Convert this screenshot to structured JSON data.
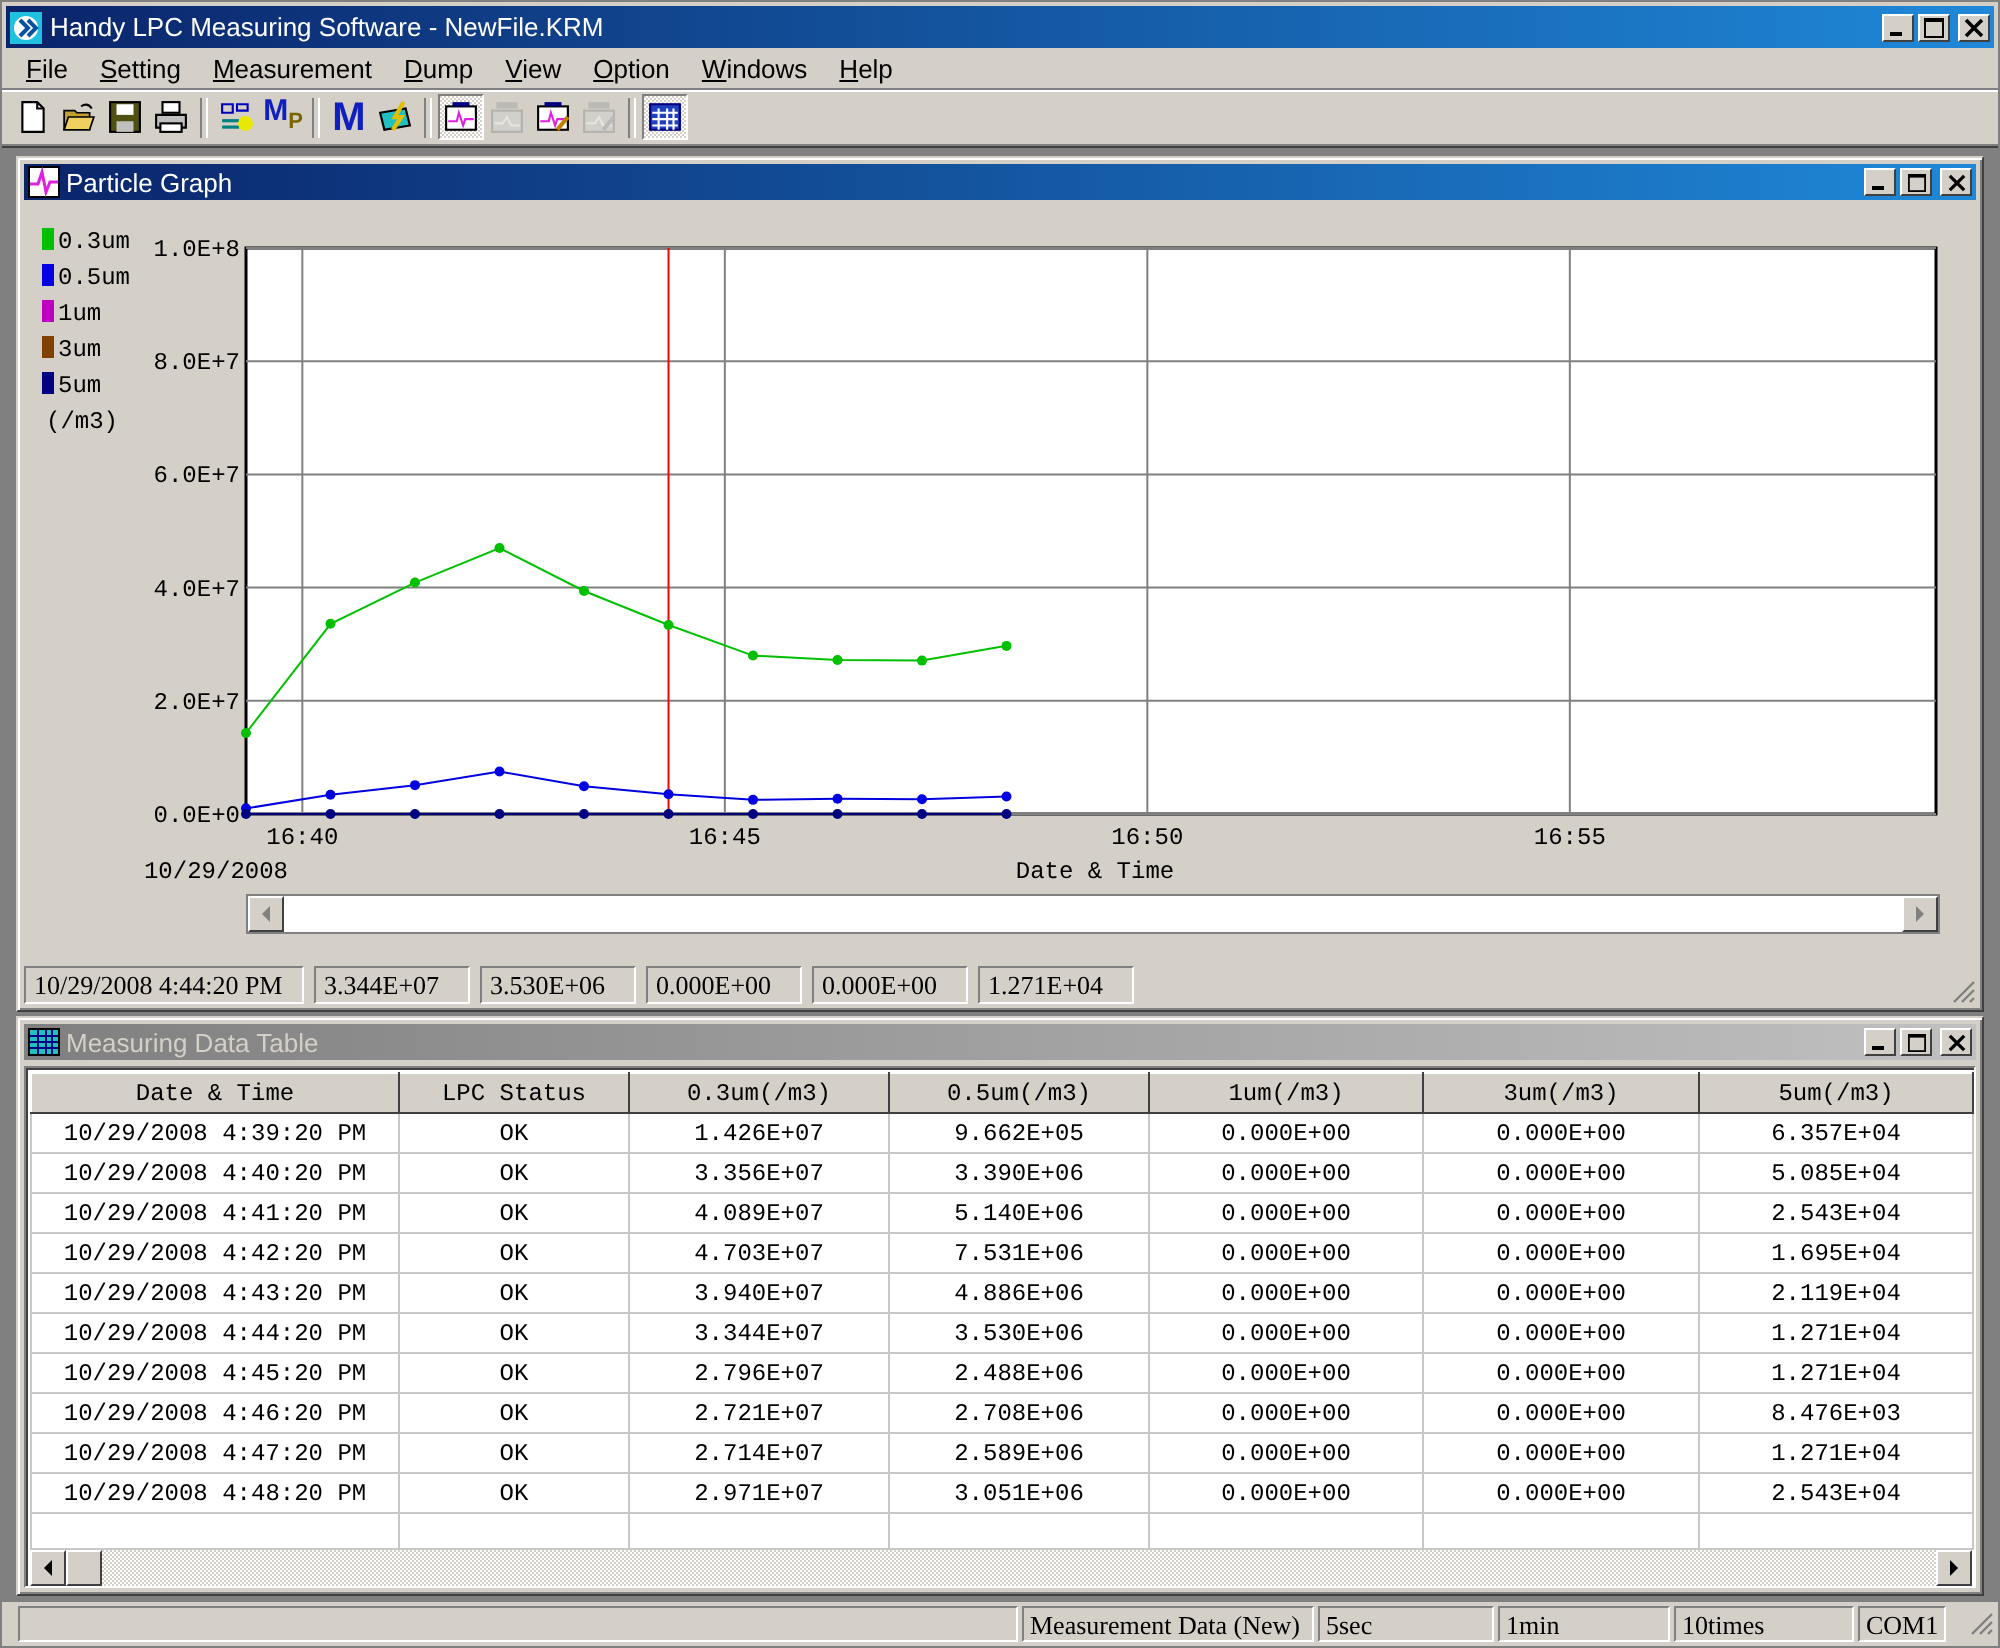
{
  "window": {
    "title": "Handy LPC Measuring Software - NewFile.KRM"
  },
  "menu": [
    "File",
    "Setting",
    "Measurement",
    "Dump",
    "View",
    "Option",
    "Windows",
    "Help"
  ],
  "toolbar": [
    {
      "kind": "new",
      "pressed": false,
      "disabled": false
    },
    {
      "kind": "open",
      "pressed": false,
      "disabled": false
    },
    {
      "kind": "save",
      "pressed": false,
      "disabled": false
    },
    {
      "kind": "print",
      "pressed": false,
      "disabled": false
    },
    {
      "kind": "separator"
    },
    {
      "kind": "rs",
      "pressed": false,
      "disabled": false
    },
    {
      "kind": "letter-sub",
      "label": "M",
      "sub": "P",
      "pressed": false,
      "disabled": false
    },
    {
      "kind": "separator"
    },
    {
      "kind": "letter",
      "label": "M",
      "pressed": false,
      "disabled": false
    },
    {
      "kind": "meter",
      "pressed": false,
      "disabled": false
    },
    {
      "kind": "separator"
    },
    {
      "kind": "graph",
      "pressed": true,
      "disabled": false
    },
    {
      "kind": "thv",
      "pressed": false,
      "disabled": true
    },
    {
      "kind": "graph-edit",
      "pressed": false,
      "disabled": false
    },
    {
      "kind": "thv-edit",
      "pressed": false,
      "disabled": true
    },
    {
      "kind": "separator"
    },
    {
      "kind": "table",
      "pressed": true,
      "disabled": false
    }
  ],
  "graph_window": {
    "title": "Particle Graph",
    "active": true,
    "date_label": "10/29/2008",
    "chart_data": {
      "type": "line",
      "xlabel": "Date & Time",
      "ylabel": "(/m3)",
      "x": [
        999.3333,
        1000.3333,
        1001.3333,
        1002.3333,
        1003.3333,
        1004.3333,
        1005.3333,
        1006.3333,
        1007.3333,
        1008.3333
      ],
      "series": [
        {
          "name": "0.3um",
          "color": "#00c000",
          "marker": "circle",
          "values": [
            14300000,
            33600000,
            40900000,
            47000000,
            39400000,
            33400000,
            28000000,
            27200000,
            27100000,
            29700000
          ]
        },
        {
          "name": "0.5um",
          "color": "#0000e0",
          "marker": "circle",
          "values": [
            1000000,
            3400000,
            5100000,
            7500000,
            4900000,
            3500000,
            2500000,
            2700000,
            2600000,
            3100000
          ]
        },
        {
          "name": "1um",
          "color": "#c000c0",
          "values": [
            null,
            null,
            null,
            null,
            null,
            null,
            null,
            null,
            null,
            null
          ]
        },
        {
          "name": "3um",
          "color": "#804000",
          "values": [
            null,
            null,
            null,
            null,
            null,
            null,
            null,
            null,
            null,
            null
          ]
        },
        {
          "name": "5um",
          "color": "#000080",
          "marker": "circle",
          "values": [
            0,
            0,
            0,
            0,
            0,
            0,
            0,
            0,
            0,
            0
          ]
        }
      ],
      "grid": true,
      "legend": "left",
      "xlim": [
        999.3333,
        1019.3333
      ],
      "ylim": [
        0,
        100000000
      ],
      "xticks": [
        {
          "value": 1000,
          "label": "16:40"
        },
        {
          "value": 1005,
          "label": "16:45"
        },
        {
          "value": 1010,
          "label": "16:50"
        },
        {
          "value": 1015,
          "label": "16:55"
        }
      ],
      "yticks": [
        {
          "value": 0,
          "label": "0.0E+0"
        },
        {
          "value": 20000000,
          "label": "2.0E+7"
        },
        {
          "value": 40000000,
          "label": "4.0E+7"
        },
        {
          "value": 60000000,
          "label": "6.0E+7"
        },
        {
          "value": 80000000,
          "label": "8.0E+7"
        },
        {
          "value": 100000000,
          "label": "1.0E+8"
        }
      ],
      "ref_lines": [
        {
          "axis": "x",
          "value": 1004.3333
        }
      ]
    },
    "readings": [
      "10/29/2008 4:44:20 PM",
      "3.344E+07",
      "3.530E+06",
      "0.000E+00",
      "0.000E+00",
      "1.271E+04"
    ]
  },
  "table_window": {
    "title": "Measuring Data Table",
    "active": false,
    "columns": [
      "Date & Time",
      "LPC Status",
      "0.3um(/m3)",
      "0.5um(/m3)",
      "1um(/m3)",
      "3um(/m3)",
      "5um(/m3)"
    ],
    "rows": [
      [
        "10/29/2008 4:39:20 PM",
        "OK",
        "1.426E+07",
        "9.662E+05",
        "0.000E+00",
        "0.000E+00",
        "6.357E+04"
      ],
      [
        "10/29/2008 4:40:20 PM",
        "OK",
        "3.356E+07",
        "3.390E+06",
        "0.000E+00",
        "0.000E+00",
        "5.085E+04"
      ],
      [
        "10/29/2008 4:41:20 PM",
        "OK",
        "4.089E+07",
        "5.140E+06",
        "0.000E+00",
        "0.000E+00",
        "2.543E+04"
      ],
      [
        "10/29/2008 4:42:20 PM",
        "OK",
        "4.703E+07",
        "7.531E+06",
        "0.000E+00",
        "0.000E+00",
        "1.695E+04"
      ],
      [
        "10/29/2008 4:43:20 PM",
        "OK",
        "3.940E+07",
        "4.886E+06",
        "0.000E+00",
        "0.000E+00",
        "2.119E+04"
      ],
      [
        "10/29/2008 4:44:20 PM",
        "OK",
        "3.344E+07",
        "3.530E+06",
        "0.000E+00",
        "0.000E+00",
        "1.271E+04"
      ],
      [
        "10/29/2008 4:45:20 PM",
        "OK",
        "2.796E+07",
        "2.488E+06",
        "0.000E+00",
        "0.000E+00",
        "1.271E+04"
      ],
      [
        "10/29/2008 4:46:20 PM",
        "OK",
        "2.721E+07",
        "2.708E+06",
        "0.000E+00",
        "0.000E+00",
        "8.476E+03"
      ],
      [
        "10/29/2008 4:47:20 PM",
        "OK",
        "2.714E+07",
        "2.589E+06",
        "0.000E+00",
        "0.000E+00",
        "1.271E+04"
      ],
      [
        "10/29/2008 4:48:20 PM",
        "OK",
        "2.971E+07",
        "3.051E+06",
        "0.000E+00",
        "0.000E+00",
        "2.543E+04"
      ]
    ]
  },
  "status_bar": [
    "Measurement Data (New)",
    "5sec",
    "1min",
    "10times",
    "COM1"
  ]
}
